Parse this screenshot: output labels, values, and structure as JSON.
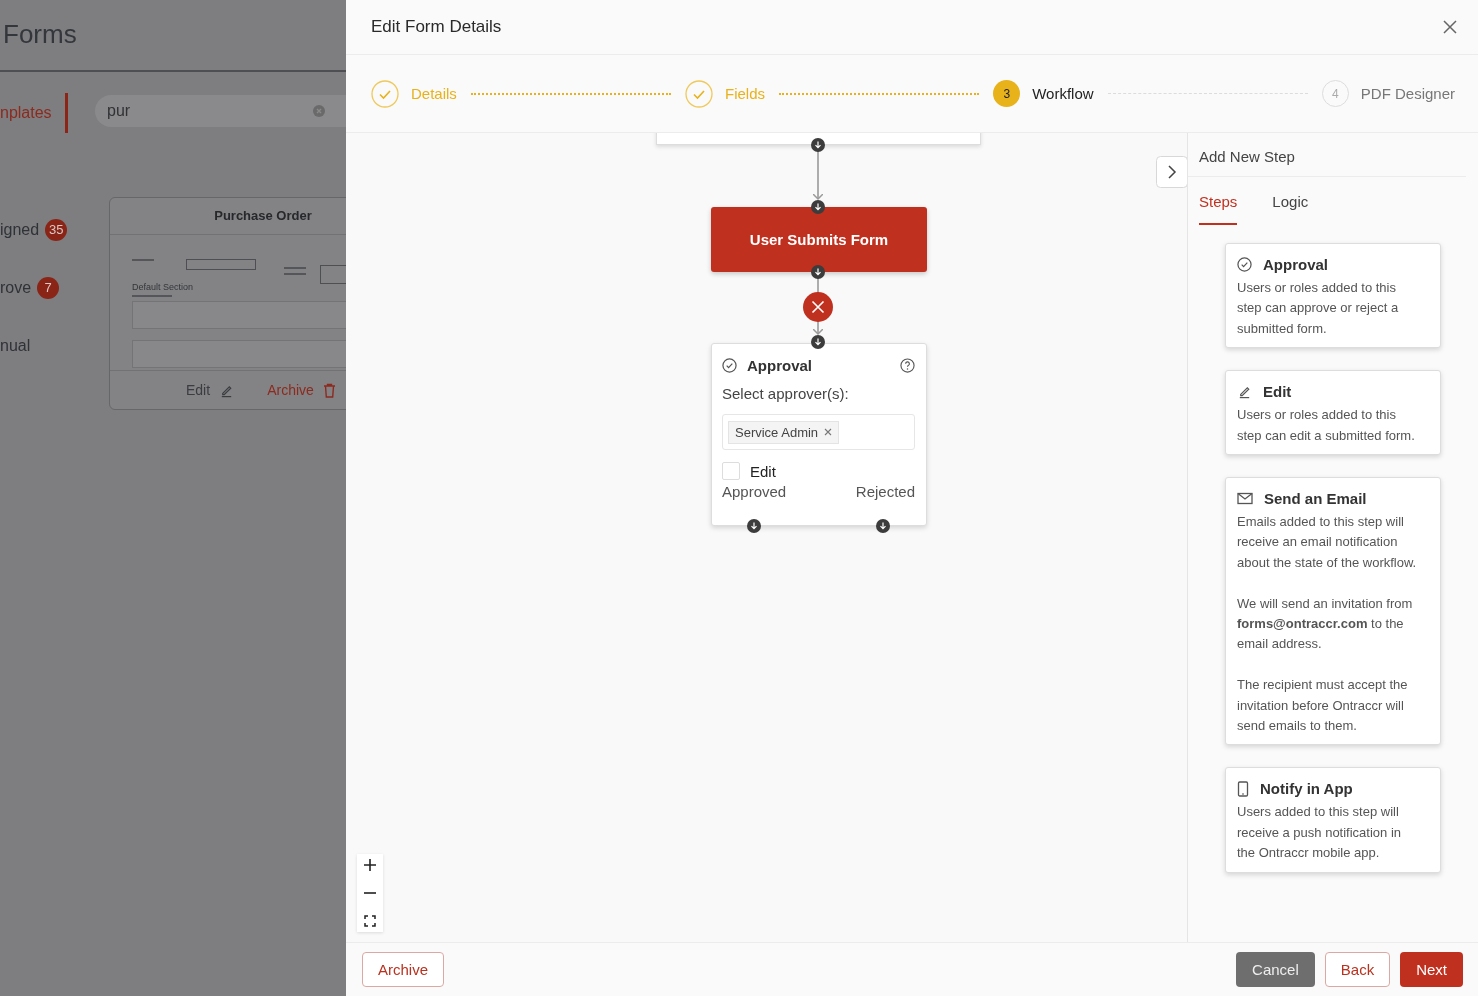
{
  "background": {
    "title": "Forms",
    "tab": "nplates",
    "search": {
      "value": "pur"
    },
    "nav": [
      {
        "label": "igned",
        "count": "35"
      },
      {
        "label": "rove",
        "count": "7"
      },
      {
        "label": "nual"
      }
    ],
    "card": {
      "title": "Purchase Order",
      "preview": {
        "section": "Default Section"
      },
      "actions": [
        {
          "label": "Edit",
          "kind": "edit"
        },
        {
          "label": "Archive",
          "kind": "archive"
        }
      ]
    }
  },
  "dialog": {
    "title": "Edit Form Details"
  },
  "steps": [
    {
      "label": "Details",
      "completed": true,
      "active": false
    },
    {
      "label": "Fields",
      "completed": true,
      "active": false
    },
    {
      "number": "3",
      "label": "Workflow",
      "completed": false,
      "active": true
    },
    {
      "number": "4",
      "label": "PDF Designer",
      "completed": false,
      "active": false
    }
  ],
  "canvas": {
    "trigger": {
      "label": "User Submits Form"
    },
    "approval": {
      "title": "Approval",
      "field_label": "Select approver(s):",
      "tags": [
        {
          "label": "Service Admin"
        }
      ],
      "checkbox": {
        "label": "Edit",
        "checked": false
      },
      "outputs": [
        "Approved",
        "Rejected"
      ]
    }
  },
  "panel": {
    "title": "Add New Step",
    "tabs": [
      {
        "label": "Steps",
        "selected": true
      },
      {
        "label": "Logic",
        "selected": false
      }
    ],
    "cards": [
      {
        "kind": "approval",
        "title": "Approval",
        "paragraphs": [
          "Users or roles added to this step can approve or reject a submitted form."
        ]
      },
      {
        "kind": "edit",
        "title": "Edit",
        "paragraphs": [
          "Users or roles added to this step can edit a submitted form."
        ]
      },
      {
        "kind": "email",
        "title": "Send an Email",
        "paragraphs": [
          "Emails added to this step will receive an email notification about the state of the workflow.",
          "We will send an invitation from **forms@ontraccr.com** to the email address.",
          "The recipient must accept the invitation before Ontraccr will send emails to them."
        ]
      },
      {
        "kind": "app",
        "title": "Notify in App",
        "paragraphs": [
          "Users added to this step will receive a push notification in the Ontraccr mobile app."
        ]
      }
    ]
  },
  "footer": {
    "left": [
      {
        "label": "Archive",
        "kind": "outline"
      }
    ],
    "right": [
      {
        "label": "Cancel",
        "kind": "secondary"
      },
      {
        "label": "Back",
        "kind": "outline"
      },
      {
        "label": "Next",
        "kind": "primary"
      }
    ]
  }
}
